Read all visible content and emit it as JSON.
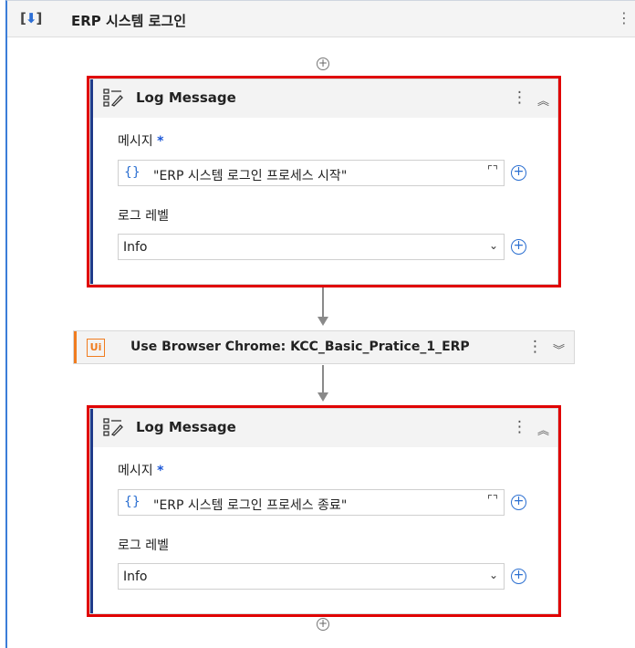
{
  "sequence": {
    "title": "ERP 시스템 로그인",
    "icon": "sequence-icon"
  },
  "log1": {
    "title": "Log Message",
    "message_label": "메시지",
    "required_mark": "*",
    "message_value": "\"ERP 시스템 로그인 프로세스 시작\"",
    "level_label": "로그 레벨",
    "level_value": "Info"
  },
  "browser": {
    "title": "Use Browser Chrome: KCC_Basic_Pratice_1_ERP",
    "icon_text": "Ui"
  },
  "log2": {
    "title": "Log Message",
    "message_label": "메시지",
    "required_mark": "*",
    "message_value": "\"ERP 시스템 로그인 프로세스 종료\"",
    "level_label": "로그 레벨",
    "level_value": "Info"
  },
  "glyphs": {
    "kebab": "⋮",
    "collapse": "︽",
    "expand": "︾",
    "braces": "{}",
    "plus": "+",
    "caret": "⌄",
    "expand_field": "⌜⌝"
  },
  "colors": {
    "accent_blue": "#1f3a8a",
    "highlight_red": "#e00000",
    "uipath_orange": "#f07c1f",
    "link_blue": "#2b6fd1"
  }
}
